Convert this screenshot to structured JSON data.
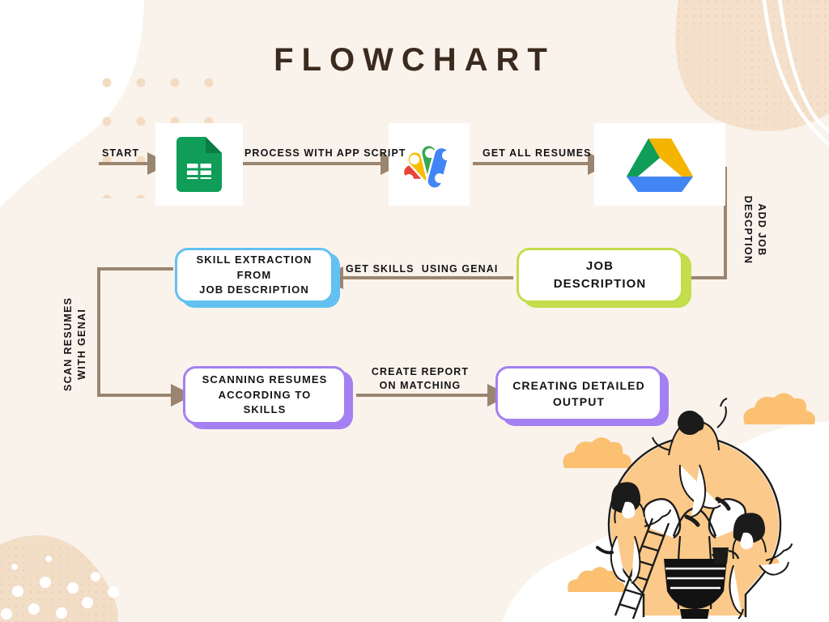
{
  "page": {
    "title": "FLOWCHART",
    "background_color": "#faf3ec",
    "title_color": "#3b2a1e",
    "connector_color": "#9a8570"
  },
  "nodes": [
    {
      "id": "sheets",
      "kind": "icon-card",
      "icon": "google-sheets-icon",
      "name": "Google Sheets"
    },
    {
      "id": "appscript",
      "kind": "icon-card",
      "icon": "google-apps-script-icon",
      "name": "Google Apps Script"
    },
    {
      "id": "drive",
      "kind": "icon-card",
      "icon": "google-drive-icon",
      "name": "Google Drive"
    },
    {
      "id": "job-description",
      "kind": "box",
      "lines": [
        "JOB",
        "DESCRIPTION"
      ],
      "accent": "#c3de4a",
      "font_size": 15
    },
    {
      "id": "skill-extraction",
      "kind": "box",
      "lines": [
        "SKILL EXTRACTION FROM",
        "JOB DESCRIPTION"
      ],
      "accent": "#62c1f0",
      "font_size": 13
    },
    {
      "id": "scanning-resumes",
      "kind": "box",
      "lines": [
        "SCANNING RESUMES",
        "ACCORDING TO",
        "SKILLS"
      ],
      "accent": "#a480f2",
      "font_size": 13
    },
    {
      "id": "creating-output",
      "kind": "box",
      "lines": [
        "CREATING DETAILED",
        "OUTPUT"
      ],
      "accent": "#a480f2",
      "font_size": 14
    }
  ],
  "connectors": {
    "start": "START",
    "process_with_app_script": "PROCESS WITH APP SCRIPT",
    "get_all_resumes": "GET ALL RESUMES",
    "add_job_description": "ADD JOB\nDESCPTION",
    "get_skills_using_genai": "GET SKILLS  USING GENAI",
    "scan_resumes_with_genai": "SCAN RESUMES\nWITH GENAI",
    "create_report_on_matching": "CREATE REPORT\nON MATCHING"
  },
  "illustration": {
    "name": "lightbulb-teamwork-illustration",
    "bulb_color": "#fbc989",
    "cloud_color": "#fbc072"
  }
}
